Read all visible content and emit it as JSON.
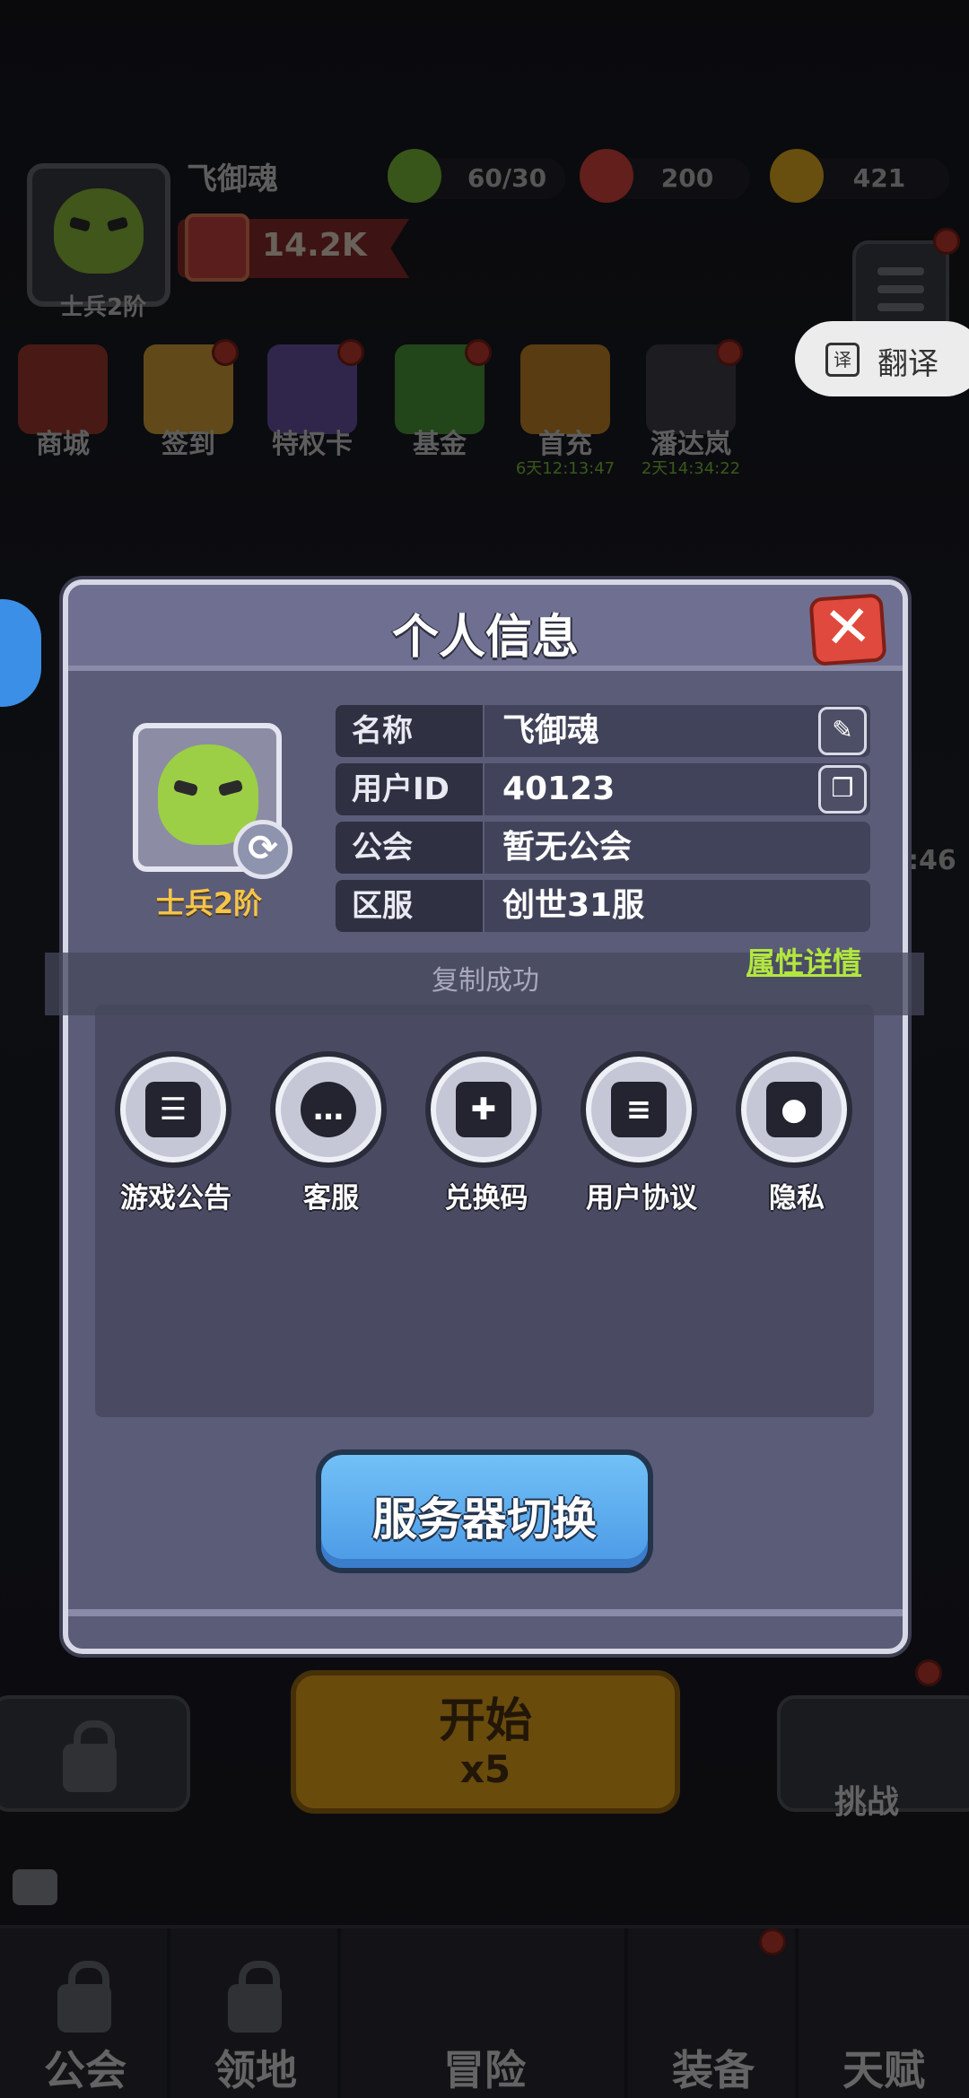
{
  "hud": {
    "player_name": "飞御魂",
    "rank": "士兵2阶",
    "power": "14.2K",
    "resources": [
      {
        "name": "stamina",
        "value": "60/30",
        "color": "#7fbf3a"
      },
      {
        "name": "gems",
        "value": "200",
        "color": "#d9463c"
      },
      {
        "name": "gold",
        "value": "421",
        "color": "#e6b023"
      }
    ],
    "translate_label": "翻译",
    "features": [
      {
        "label": "商城",
        "timer": ""
      },
      {
        "label": "签到",
        "timer": ""
      },
      {
        "label": "特权卡",
        "timer": ""
      },
      {
        "label": "基金",
        "timer": ""
      },
      {
        "label": "首充",
        "timer": "6天12:13:47"
      },
      {
        "label": "潘达岚",
        "timer": "2天14:34:22"
      }
    ],
    "side_timer": ":46",
    "start_label": "开始",
    "start_cost": "x5",
    "challenge_label": "挑战",
    "tabs": [
      "公会",
      "领地",
      "冒险",
      "装备",
      "天赋"
    ]
  },
  "modal": {
    "title": "个人信息",
    "rank": "士兵2阶",
    "rows": [
      {
        "key": "名称",
        "value": "飞御魂"
      },
      {
        "key": "用户ID",
        "value": "40123"
      },
      {
        "key": "公会",
        "value": "暂无公会"
      },
      {
        "key": "区服",
        "value": "创世31服"
      }
    ],
    "toast": "复制成功",
    "attr_link": "属性详情",
    "functions": [
      {
        "label": "游戏公告",
        "icon": "announcement-icon"
      },
      {
        "label": "客服",
        "icon": "customer-service-icon"
      },
      {
        "label": "兑换码",
        "icon": "gift-icon"
      },
      {
        "label": "用户协议",
        "icon": "agreement-icon"
      },
      {
        "label": "隐私",
        "icon": "lock-icon"
      }
    ],
    "server_switch": "服务器切换"
  }
}
